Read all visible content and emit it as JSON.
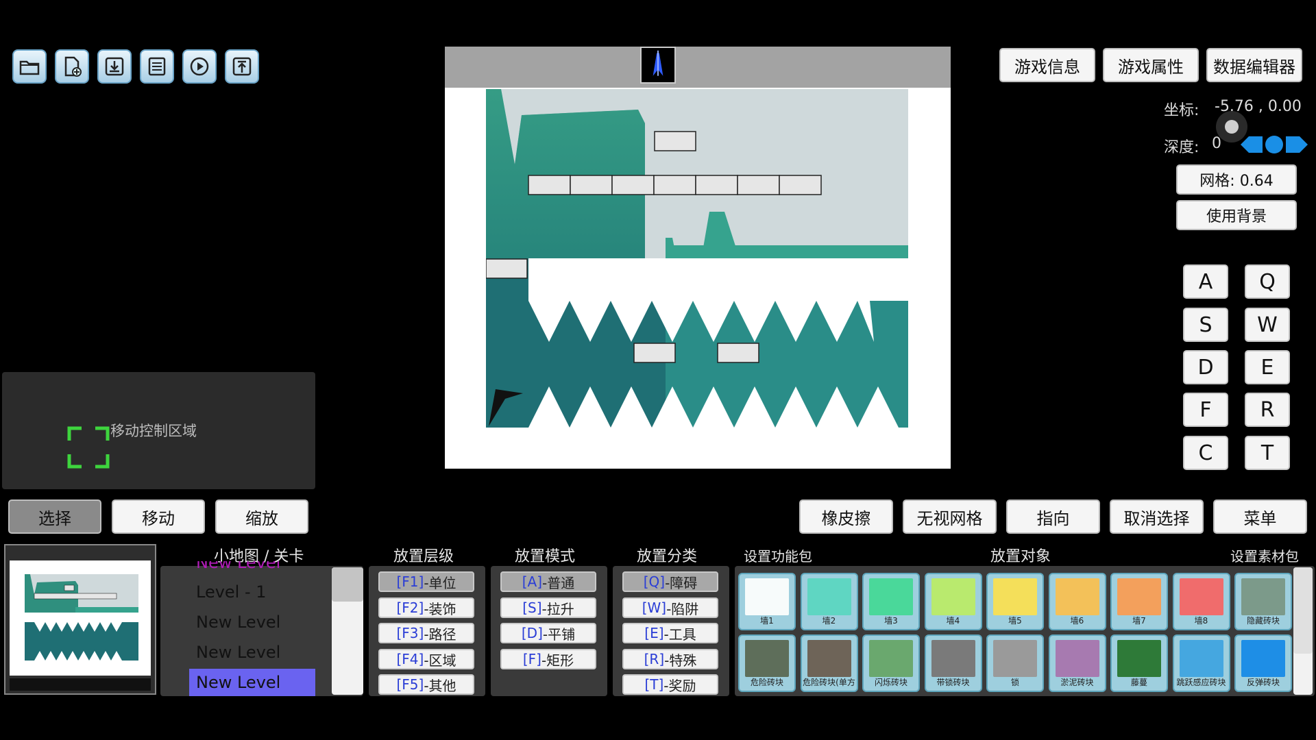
{
  "toolbar": {
    "icons": [
      "folder-icon",
      "new-file-icon",
      "download-icon",
      "save-icon",
      "play-icon",
      "upload-icon"
    ]
  },
  "header": {
    "game_info": "游戏信息",
    "game_props": "游戏属性",
    "data_editor": "数据编辑器"
  },
  "status": {
    "coord_label": "坐标:",
    "coord_value": "-5.76 , 0.00",
    "depth_label": "深度:",
    "depth_value": "0",
    "grid_button": "网格: 0.64",
    "use_bg": "使用背景"
  },
  "keys": {
    "left": [
      "A",
      "S",
      "D",
      "F",
      "C"
    ],
    "right": [
      "Q",
      "W",
      "E",
      "R",
      "T"
    ]
  },
  "move_area": {
    "label": "移动控制区域"
  },
  "modes": {
    "select": "选择",
    "move": "移动",
    "zoom": "缩放"
  },
  "actions": {
    "eraser": "橡皮擦",
    "ignore_grid": "无视网格",
    "direction": "指向",
    "deselect": "取消选择",
    "menu": "菜单"
  },
  "panels": {
    "minimap_title": "小地图 / 关卡",
    "layer_title": "放置层级",
    "mode_title": "放置模式",
    "category_title": "放置分类",
    "func_pack_title": "设置功能包",
    "objects_title": "放置对象",
    "assets_title": "设置素材包"
  },
  "levels": [
    "New Level",
    "Level - 1",
    "New Level",
    "New Level",
    "New Level"
  ],
  "layers": [
    {
      "key": "[F1]",
      "name": "-单位"
    },
    {
      "key": "[F2]",
      "name": "-装饰"
    },
    {
      "key": "[F3]",
      "name": "-路径"
    },
    {
      "key": "[F4]",
      "name": "-区域"
    },
    {
      "key": "[F5]",
      "name": "-其他"
    }
  ],
  "place_modes": [
    {
      "key": "[A]",
      "name": "-普通"
    },
    {
      "key": "[S]",
      "name": "-拉升"
    },
    {
      "key": "[D]",
      "name": "-平铺"
    },
    {
      "key": "[F]",
      "name": "-矩形"
    }
  ],
  "categories": [
    {
      "key": "[Q]",
      "name": "-障碍"
    },
    {
      "key": "[W]",
      "name": "-陷阱"
    },
    {
      "key": "[E]",
      "name": "-工具"
    },
    {
      "key": "[R]",
      "name": "-特殊"
    },
    {
      "key": "[T]",
      "name": "-奖励"
    }
  ],
  "objects_row1": [
    {
      "label": "墙1",
      "color": "#f7fbfb"
    },
    {
      "label": "墙2",
      "color": "#5fd6c2"
    },
    {
      "label": "墙3",
      "color": "#4ad89a"
    },
    {
      "label": "墙4",
      "color": "#b9ea6e"
    },
    {
      "label": "墙5",
      "color": "#f4df5a"
    },
    {
      "label": "墙6",
      "color": "#f3c159"
    },
    {
      "label": "墙7",
      "color": "#f3a05c"
    },
    {
      "label": "墙8",
      "color": "#f06c6c"
    },
    {
      "label": "隐藏砖块",
      "color": "#7c9a8a"
    }
  ],
  "objects_row2": [
    {
      "label": "危险砖块",
      "color": "#5e6e5a"
    },
    {
      "label": "危险砖块(单方",
      "color": "#6e6458"
    },
    {
      "label": "闪烁砖块",
      "color": "#6aa86e"
    },
    {
      "label": "带锁砖块",
      "color": "#7a7a7a"
    },
    {
      "label": "锁",
      "color": "#9a9a9a"
    },
    {
      "label": "淤泥砖块",
      "color": "#a77ab0"
    },
    {
      "label": "藤蔓",
      "color": "#2e7a38"
    },
    {
      "label": "跳跃感应砖块",
      "color": "#45a7e0"
    },
    {
      "label": "反弹砖块",
      "color": "#1e8ee6"
    }
  ]
}
